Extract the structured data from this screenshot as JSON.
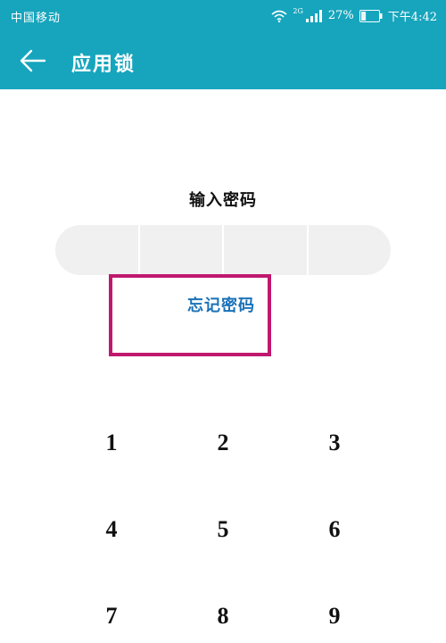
{
  "status_bar": {
    "carrier": "中国移动",
    "network": "2G",
    "battery": "27%",
    "battery_level": 0.27,
    "time": "下午4:42"
  },
  "app_bar": {
    "title": "应用锁",
    "back_icon": "arrow-left-icon"
  },
  "main": {
    "prompt": "输入密码",
    "pin_length": 4,
    "forgot_label": "忘记密码"
  },
  "keypad": {
    "keys": [
      "1",
      "2",
      "3",
      "4",
      "5",
      "6",
      "7",
      "8",
      "9"
    ]
  },
  "colors": {
    "accent": "#16a5bd",
    "link": "#1a72b8",
    "highlight": "#c0186e"
  }
}
